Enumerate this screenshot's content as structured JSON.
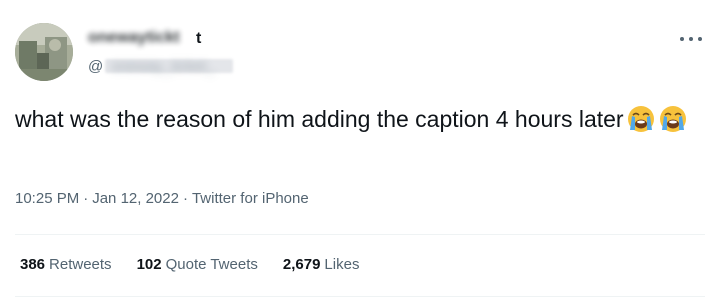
{
  "author": {
    "display_name_redacted": "onewaytickt",
    "display_name_visible_tail": "t",
    "handle_prefix": "@",
    "handle_redacted": "oneway_ticket_"
  },
  "tweet": {
    "text": "what was the reason of him adding the caption 4 hours later",
    "emojis": [
      "loudly-crying-face",
      "loudly-crying-face"
    ]
  },
  "meta": {
    "time": "10:25 PM",
    "separator": "·",
    "date": "Jan 12, 2022",
    "source": "Twitter for iPhone"
  },
  "stats": [
    {
      "count": "386",
      "label": "Retweets"
    },
    {
      "count": "102",
      "label": "Quote Tweets"
    },
    {
      "count": "2,679",
      "label": "Likes"
    }
  ],
  "colors": {
    "text_primary": "#0f1419",
    "text_secondary": "#536471",
    "divider": "#eff3f4",
    "emoji_face": "#f7c23c",
    "emoji_tears": "#52a8e8"
  }
}
